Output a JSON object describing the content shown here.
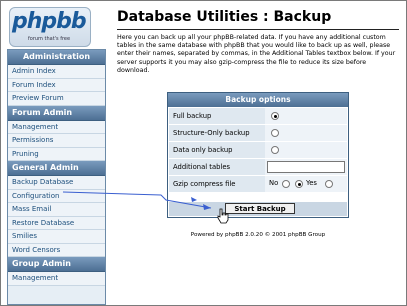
{
  "logo": {
    "text": "phpbb",
    "tagline": "forum that's free"
  },
  "sidebar": {
    "sections": [
      {
        "title": "Administration",
        "items": [
          "Admin Index",
          "Forum Index",
          "Preview Forum"
        ]
      },
      {
        "title": "Forum Admin",
        "items": [
          "Management",
          "Permissions",
          "Pruning"
        ]
      },
      {
        "title": "General Admin",
        "items": [
          "Backup Database",
          "Configuration",
          "Mass Email",
          "Restore Database",
          "Smilies",
          "Word Censors"
        ]
      },
      {
        "title": "Group Admin",
        "items": [
          "Management"
        ]
      }
    ]
  },
  "main": {
    "title": "Database Utilities : Backup",
    "description": "Here you can back up all your phpBB-related data. If you have any additional custom tables in the same database with phpBB that you would like to back up as well, please enter their names, separated by commas, in the Additional Tables textbox below. If your server supports it you may also gzip-compress the file to reduce its size before download.",
    "options": {
      "header": "Backup options",
      "full_backup": "Full backup",
      "structure_only": "Structure-Only backup",
      "data_only": "Data only backup",
      "additional_tables": "Additional tables",
      "additional_tables_value": "",
      "gzip": "Gzip compress file",
      "gzip_no": "No",
      "gzip_yes": "Yes",
      "selected_backup": "full",
      "gzip_selected": "yes"
    },
    "start_button": "Start Backup",
    "footer": "Powered by phpBB 2.0.20 © 2001 phpBB Group"
  },
  "annotation": {
    "arrow_color": "#3a5fd0"
  }
}
